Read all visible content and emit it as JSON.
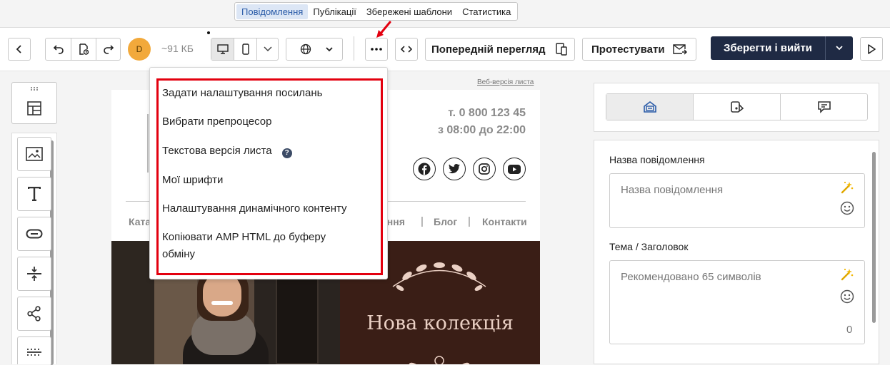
{
  "top_tabs": [
    "Повідомлення",
    "Публікації",
    "Збережені шаблони",
    "Статистика"
  ],
  "toolbar": {
    "avatar_letter": "D",
    "size": "~91 КБ",
    "preview_label": "Попередній перегляд",
    "test_label": "Протестувати",
    "save_label": "Зберегти і вийти"
  },
  "canvas": {
    "web_version_link": "Веб-версія листа",
    "phone": "т. 0 800 123 45",
    "hours": "з 08:00 до 22:00",
    "nav_left": "Ката",
    "nav_mid": "ання",
    "nav_blog": "Блог",
    "nav_contacts": "Контакти",
    "hero_title": "Нова колекція"
  },
  "dropdown": {
    "items": [
      "Задати налаштування посилань",
      "Вибрати препроцесор",
      "Текстова версія листа",
      "Мої шрифти",
      "Налаштування динамічного контенту",
      "Копіювати AMP HTML до буферу",
      "обміну"
    ]
  },
  "right_panel": {
    "name_label": "Назва повідомлення",
    "name_placeholder": "Назва повідомлення",
    "subject_label": "Тема / Заголовок",
    "subject_placeholder": "Рекомендовано 65 символів",
    "subject_count": "0"
  },
  "colors": {
    "save_button_bg": "#1f2a44",
    "highlight_red": "#e3000f",
    "hero_bg": "#3a1e16",
    "avatar_bg": "#f2a93b"
  }
}
